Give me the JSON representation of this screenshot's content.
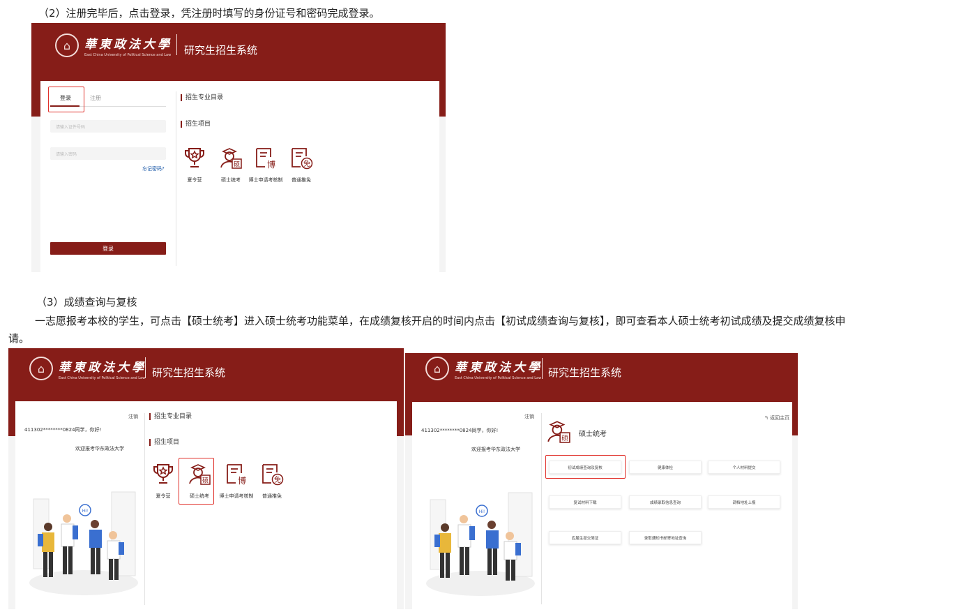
{
  "paragraphs": {
    "step2": "（2）注册完毕后，点击登录，凭注册时填写的身份证号和密码完成登录。",
    "step3_title": "（3）成绩查询与复核",
    "step3_body_line1": "一志愿报考本校的学生，可点击【硕士统考】进入硕士统考功能菜单，在成绩复核开启的时间内点击【初试成绩查询与复核】，即可查看本人硕士统考初试成绩及提交成绩复核申",
    "step3_body_line2": "请。"
  },
  "header": {
    "logo_cn": "華東政法大學",
    "logo_en": "East China University of Political Science and Law",
    "system_title": "研究生招生系统"
  },
  "login": {
    "tab_login": "登录",
    "tab_register": "注册",
    "id_placeholder": "请输入证件号码",
    "password_placeholder": "请输入密码",
    "forgot_link": "忘记密码?",
    "login_button": "登录"
  },
  "sections": {
    "catalog": "招生专业目录",
    "projects": "招生项目"
  },
  "projects": [
    {
      "label": "夏令营",
      "icon": "trophy-icon"
    },
    {
      "label": "硕士统考",
      "icon": "master-exam-icon"
    },
    {
      "label": "博士申请考核制",
      "icon": "doctor-icon"
    },
    {
      "label": "普通推免",
      "icon": "exempt-icon"
    }
  ],
  "dashboard": {
    "logout": "注销",
    "greeting": "411302********0824同学，你好!",
    "welcome": "欢迎报考华东政法大学",
    "illustration_sign": "Hi!"
  },
  "master_menu": {
    "back_home": "返回主页",
    "title": "硕士统考",
    "buttons": [
      "初试成绩查询及复核",
      "健康体检",
      "个人材料提交",
      "复试材料下载",
      "成绩录取信息查询",
      "调档地址上报",
      "应届生提交简证",
      "录取通知书邮寄地址查询"
    ]
  },
  "colors": {
    "brand": "#861d18",
    "highlight": "#e0302a",
    "link": "#1d5aa8"
  }
}
